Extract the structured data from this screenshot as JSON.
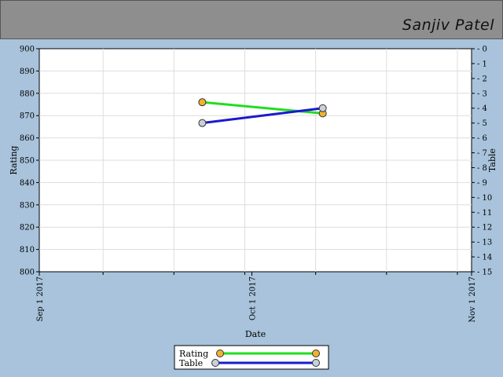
{
  "header": {
    "player_name": "Sanjiv Patel",
    "background": "#8e8e8e"
  },
  "chart_data": {
    "type": "line",
    "xlabel": "Date",
    "ylabel_left": "Rating",
    "ylabel_right": "Table",
    "x_ticks": [
      "Sep 1 2017",
      "Oct 1 2017",
      "Nov 1 2017"
    ],
    "xlim": [
      "2017-09-01",
      "2017-11-01"
    ],
    "ylim_left": [
      800,
      900
    ],
    "ylim_right": [
      0,
      15
    ],
    "right_axis_inverted": true,
    "grid": true,
    "legend_placement": "bottom-center",
    "series": [
      {
        "name": "Rating",
        "axis": "left",
        "color": "#22dd22",
        "marker_color": "#f2b22e",
        "points": [
          {
            "x": "2017-09-24",
            "y": 876
          },
          {
            "x": "2017-10-11",
            "y": 871
          }
        ]
      },
      {
        "name": "Table",
        "axis": "right",
        "color": "#1a1ad0",
        "marker_color": "#c8d0dc",
        "points": [
          {
            "x": "2017-09-24",
            "y": 5
          },
          {
            "x": "2017-10-11",
            "y": 4
          }
        ]
      }
    ]
  }
}
